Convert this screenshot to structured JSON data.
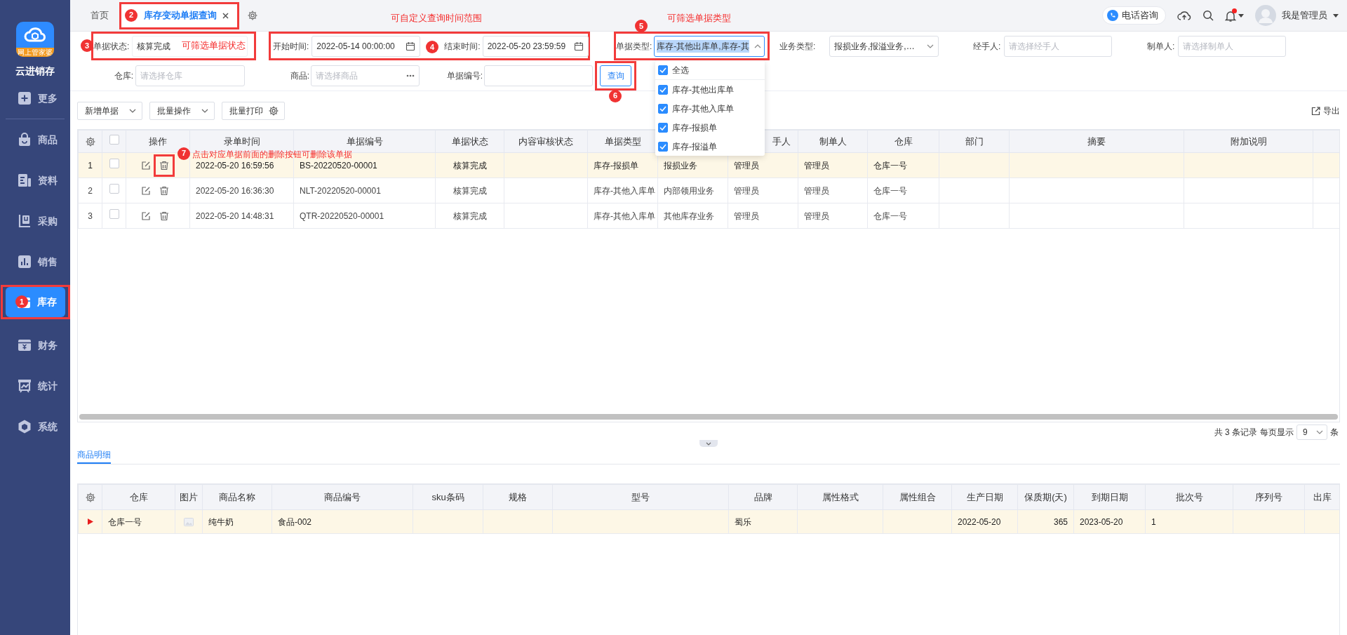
{
  "sidebar": {
    "logo_caption": "网上管家婆",
    "app_name": "云进销存",
    "items": [
      {
        "label": "更多",
        "selected": false
      },
      {
        "label": "商品",
        "selected": false
      },
      {
        "label": "资料",
        "selected": false
      },
      {
        "label": "采购",
        "selected": false
      },
      {
        "label": "销售",
        "selected": false
      },
      {
        "label": "库存",
        "selected": true
      },
      {
        "label": "财务",
        "selected": false
      },
      {
        "label": "统计",
        "selected": false
      },
      {
        "label": "系统",
        "selected": false
      }
    ]
  },
  "tabs": [
    {
      "label": "首页",
      "selected": false,
      "closable": false
    },
    {
      "label": "库存变动单据查询",
      "selected": true,
      "closable": true
    }
  ],
  "header": {
    "phone_button": "电话咨询",
    "has_notification": true,
    "user_name": "我是管理员"
  },
  "filters": {
    "status": {
      "label": "单据状态:",
      "value": "核算完成"
    },
    "start_time": {
      "label": "开始时间:",
      "value": "2022-05-14 00:00:00"
    },
    "end_time": {
      "label": "结束时间:",
      "value": "2022-05-20 23:59:59"
    },
    "doc_type": {
      "label": "单据类型:",
      "value": "库存-其他出库单,库存-其",
      "expanded": true,
      "options": [
        {
          "label": "全选",
          "checked": true
        },
        {
          "label": "库存-其他出库单",
          "checked": true
        },
        {
          "label": "库存-其他入库单",
          "checked": true
        },
        {
          "label": "库存-报损单",
          "checked": true
        },
        {
          "label": "库存-报溢单",
          "checked": true
        }
      ]
    },
    "biz_type": {
      "label": "业务类型:",
      "value": "报损业务,报溢业务,…"
    },
    "handler": {
      "label": "经手人:",
      "placeholder": "请选择经手人"
    },
    "maker": {
      "label": "制单人:",
      "placeholder": "请选择制单人"
    },
    "warehouse": {
      "label": "仓库:",
      "placeholder": "请选择仓库"
    },
    "product": {
      "label": "商品:",
      "placeholder": "请选择商品"
    },
    "doc_no": {
      "label": "单据编号:"
    },
    "query_button": "查询"
  },
  "toolbar": {
    "buttons": [
      {
        "label": "新增单据",
        "kind": "dropdown"
      },
      {
        "label": "批量操作",
        "kind": "dropdown"
      },
      {
        "label": "批量打印",
        "kind": "settings"
      }
    ],
    "export": "导出"
  },
  "table": {
    "all_checked": false,
    "columns": [
      {
        "label": "操作",
        "kind": "actions"
      },
      {
        "label": "录单时间"
      },
      {
        "label": "单据编号"
      },
      {
        "label": "单据状态"
      },
      {
        "label": "内容审核状态"
      },
      {
        "label": "单据类型"
      },
      {},
      {
        "label": "手人",
        "partly_covered": true
      },
      {
        "label": "制单人"
      },
      {
        "label": "仓库"
      },
      {
        "label": "部门"
      },
      {
        "label": "摘要"
      },
      {
        "label": "附加说明"
      },
      {}
    ],
    "rows": [
      {
        "index": "1",
        "selected": true,
        "checked": false,
        "cells": [
          null,
          "2022-05-20 16:59:56",
          "BS-20220520-00001",
          "核算完成",
          null,
          "库存-报损单",
          "报损业务",
          "管理员",
          "管理员",
          "仓库一号",
          null,
          null,
          null,
          null
        ]
      },
      {
        "index": "2",
        "selected": false,
        "checked": false,
        "cells": [
          null,
          "2022-05-20 16:36:30",
          "NLT-20220520-00001",
          "核算完成",
          null,
          "库存-其他入库单",
          "内部领用业务",
          "管理员",
          "管理员",
          "仓库一号",
          null,
          null,
          null,
          null
        ]
      },
      {
        "index": "3",
        "selected": false,
        "checked": false,
        "cells": [
          null,
          "2022-05-20 14:48:31",
          "QTR-20220520-00001",
          "核算完成",
          null,
          "库存-其他入库单",
          "其他库存业务",
          "管理员",
          "管理员",
          "仓库一号",
          null,
          null,
          null,
          null
        ]
      }
    ]
  },
  "pagination": {
    "summary": "共 3 条记录",
    "per_page_label": "每页显示",
    "per_page": "9",
    "unit": "条"
  },
  "detail_tabs": [
    {
      "label": "商品明细",
      "selected": true
    }
  ],
  "detail_table": {
    "columns": [
      {
        "label": "仓库"
      },
      {
        "label": "图片",
        "kind": "image"
      },
      {
        "label": "商品名称"
      },
      {
        "label": "商品编号"
      },
      {
        "label": "sku条码"
      },
      {
        "label": "规格"
      },
      {
        "label": "型号"
      },
      {
        "label": "品牌"
      },
      {
        "label": "属性格式"
      },
      {
        "label": "属性组合"
      },
      {
        "label": "生产日期"
      },
      {
        "label": "保质期(天)",
        "kind": "number"
      },
      {
        "label": "到期日期"
      },
      {
        "label": "批次号"
      },
      {
        "label": "序列号"
      },
      {
        "label": "出库"
      }
    ],
    "rows": [
      {
        "current": true,
        "cells": [
          "仓库一号",
          null,
          "纯牛奶",
          "食品-002",
          null,
          null,
          null,
          "蜀乐",
          null,
          null,
          "2022-05-20",
          "365",
          "2023-05-20",
          "1",
          null,
          null
        ]
      }
    ]
  },
  "annotations": [
    {
      "number": "1",
      "kind": "sidebar_item"
    },
    {
      "number": "2",
      "kind": "tab"
    },
    {
      "number": "3",
      "kind": "status_filter",
      "text": "可筛选单据状态"
    },
    {
      "number": "4",
      "kind": "time_filter",
      "text": "可自定义查询时间范围"
    },
    {
      "number": "5",
      "kind": "type_filter",
      "text": "可筛选单据类型"
    },
    {
      "number": "6",
      "kind": "query_button"
    },
    {
      "number": "7",
      "kind": "delete_button",
      "text": "点击对应单据前面的删除按钮可删除该单据"
    }
  ]
}
